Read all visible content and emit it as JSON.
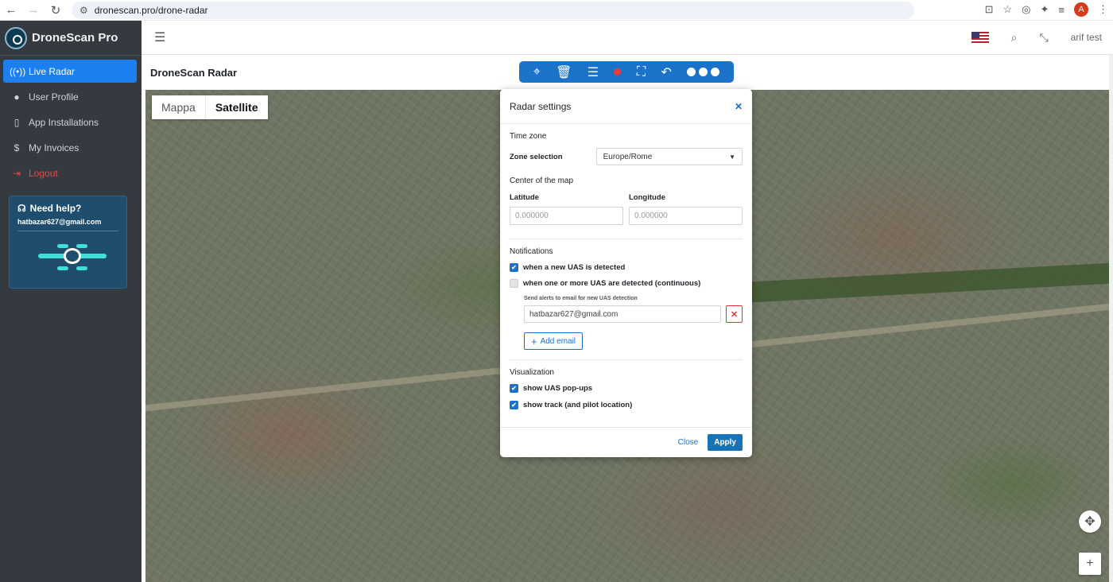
{
  "browser": {
    "url": "dronescan.pro/drone-radar",
    "profile_initial": "A"
  },
  "sidebar": {
    "brand": "DroneScan Pro",
    "items": [
      {
        "label": "Live Radar",
        "icon": "radar-icon"
      },
      {
        "label": "User Profile",
        "icon": "user-icon"
      },
      {
        "label": "App Installations",
        "icon": "phone-icon"
      },
      {
        "label": "My Invoices",
        "icon": "dollar-icon"
      },
      {
        "label": "Logout",
        "icon": "logout-icon"
      }
    ],
    "help": {
      "title": "Need help?",
      "email": "hatbazar627@gmail.com"
    }
  },
  "header": {
    "user": "arif test"
  },
  "page": {
    "title": "DroneScan Radar"
  },
  "map": {
    "types": [
      "Mappa",
      "Satellite"
    ],
    "selected": "Satellite"
  },
  "modal": {
    "title": "Radar settings",
    "time_zone": {
      "section": "Time zone",
      "label": "Zone selection",
      "value": "Europe/Rome"
    },
    "center": {
      "section": "Center of the map",
      "latitude_label": "Latitude",
      "latitude_placeholder": "0.000000",
      "longitude_label": "Longitude",
      "longitude_placeholder": "0.000000"
    },
    "notifications": {
      "section": "Notifications",
      "new_uas": "when a new UAS is detected",
      "new_uas_checked": true,
      "continuous": "when one or more UAS are detected (continuous)",
      "continuous_checked": false,
      "email_label": "Send alerts to email for new UAS detection",
      "email_value": "hatbazar627@gmail.com",
      "add_email": "Add email"
    },
    "visualization": {
      "section": "Visualization",
      "popups": "show UAS pop-ups",
      "popups_checked": true,
      "track": "show track (and pilot location)",
      "track_checked": true
    },
    "close": "Close",
    "apply": "Apply"
  },
  "colors": {
    "accent": "#1a73c8",
    "sidebar_bg": "#343a40",
    "active_item": "#1b7ff0",
    "danger": "#e14a4a"
  }
}
